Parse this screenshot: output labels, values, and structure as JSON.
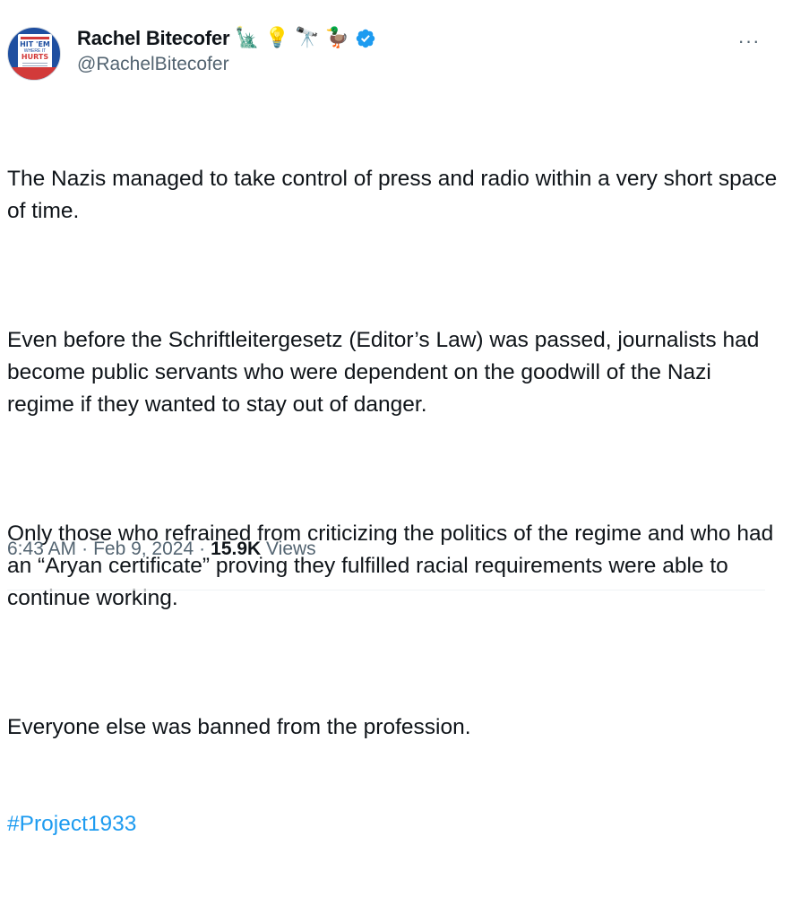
{
  "author": {
    "display_name": "Rachel Bitecofer",
    "name_emojis": [
      "🗽",
      "💡",
      "🔭",
      "🦆"
    ],
    "handle": "@RachelBitecofer",
    "verified": true,
    "avatar": {
      "line1": "HIT 'EM",
      "line2": "WHERE IT",
      "line3": "HURTS"
    }
  },
  "more_label": "···",
  "tweet": {
    "paragraphs": [
      "The Nazis managed to take control of press and radio within a very short space of time.",
      "Even before the Schriftleitergesetz (Editor’s Law) was passed, journalists had become public servants who were dependent on the goodwill of the Nazi regime if they wanted to stay out of danger.",
      "Only those who refrained from criticizing the politics of the regime and who had an “Aryan certificate” proving they fulfilled racial requirements were able to continue working.",
      "Everyone else was banned from the profession."
    ],
    "hashtag": "#Project1933"
  },
  "meta": {
    "time": "6:43 AM",
    "date": "Feb 9, 2024",
    "views_count": "15.9K",
    "views_label": "Views",
    "separator": "·"
  },
  "colors": {
    "text": "#0f1419",
    "secondary": "#536471",
    "link": "#1d9bf0",
    "verified": "#1d9bf0"
  }
}
